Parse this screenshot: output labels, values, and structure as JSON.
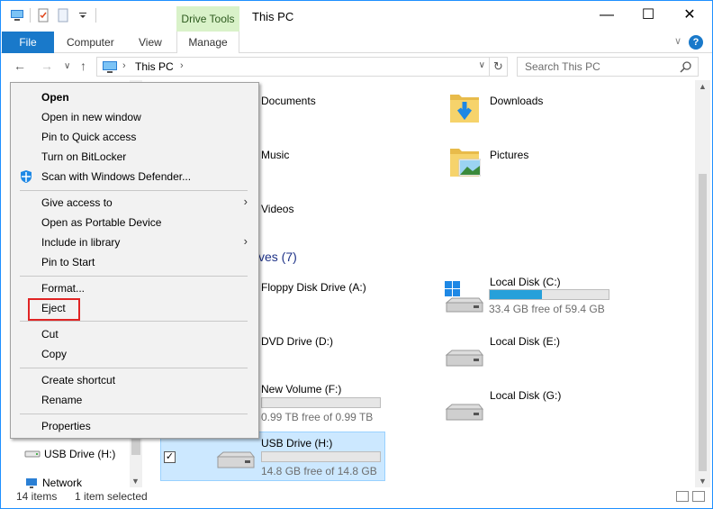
{
  "window": {
    "title": "This PC",
    "controls": {
      "minimize": "—",
      "maximize": "☐",
      "close": "✕"
    }
  },
  "ribbon": {
    "contextual_group": "Drive Tools",
    "tabs": [
      "File",
      "Computer",
      "View",
      "Manage"
    ],
    "help": "?"
  },
  "address": {
    "crumb": "This PC",
    "search_placeholder": "Search This PC"
  },
  "navpane": {
    "usb_label": "USB Drive (H:)",
    "network_label": "Network"
  },
  "content": {
    "folders": [
      {
        "name": "Documents"
      },
      {
        "name": "Downloads"
      },
      {
        "name": "Music"
      },
      {
        "name": "Pictures"
      },
      {
        "name": "Videos"
      }
    ],
    "group_title_partial": "ves (7)",
    "drives": [
      {
        "name": "Floppy Disk Drive (A:)"
      },
      {
        "name": "Local Disk (C:)",
        "free": "33.4 GB free of 59.4 GB",
        "used_fraction": 0.44
      },
      {
        "name": "DVD Drive (D:)"
      },
      {
        "name": "Local Disk (E:)"
      },
      {
        "name": "New Volume (F:)",
        "free": "0.99 TB free of 0.99 TB",
        "used_fraction": 0.0
      },
      {
        "name": "Local Disk (G:)"
      },
      {
        "name": "USB Drive (H:)",
        "free": "14.8 GB free of 14.8 GB",
        "used_fraction": 0.0
      }
    ]
  },
  "status": {
    "count": "14 items",
    "selected": "1 item selected"
  },
  "context_menu": {
    "items": [
      "Open",
      "Open in new window",
      "Pin to Quick access",
      "Turn on BitLocker",
      "Scan with Windows Defender...",
      "Give access to",
      "Open as Portable Device",
      "Include in library",
      "Pin to Start",
      "Format...",
      "Eject",
      "Cut",
      "Copy",
      "Create shortcut",
      "Rename",
      "Properties"
    ],
    "highlighted": "Eject"
  },
  "colors": {
    "accent": "#1979ca",
    "drive_tools_bg": "#d9f2c9",
    "selection_bg": "#cce8ff",
    "progress": "#26a0da",
    "highlight_box": "#e02424"
  }
}
